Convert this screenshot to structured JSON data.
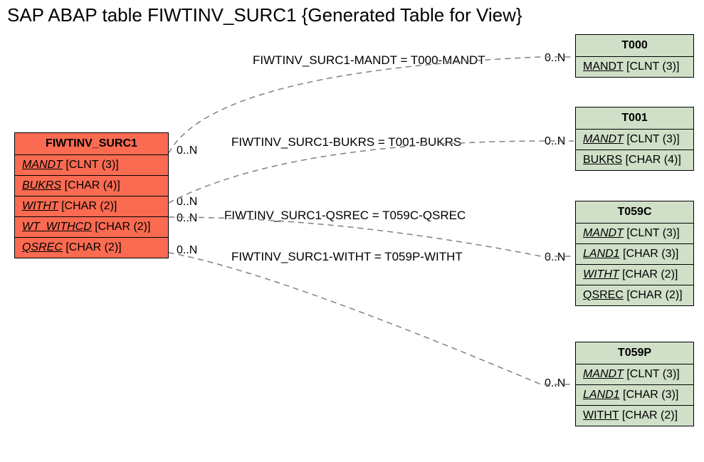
{
  "title": "SAP ABAP table FIWTINV_SURC1 {Generated Table for View}",
  "main_entity": {
    "name": "FIWTINV_SURC1",
    "fields": [
      {
        "field": "MANDT",
        "type": "[CLNT (3)]"
      },
      {
        "field": "BUKRS",
        "type": "[CHAR (4)]"
      },
      {
        "field": "WITHT",
        "type": "[CHAR (2)]"
      },
      {
        "field": "WT_WITHCD",
        "type": "[CHAR (2)]"
      },
      {
        "field": "QSREC",
        "type": "[CHAR (2)]"
      }
    ]
  },
  "related": [
    {
      "name": "T000",
      "fields": [
        {
          "field": "MANDT",
          "type": "[CLNT (3)]",
          "underline": false
        }
      ]
    },
    {
      "name": "T001",
      "fields": [
        {
          "field": "MANDT",
          "type": "[CLNT (3)]",
          "underline": true
        },
        {
          "field": "BUKRS",
          "type": "[CHAR (4)]",
          "underline": false
        }
      ]
    },
    {
      "name": "T059C",
      "fields": [
        {
          "field": "MANDT",
          "type": "[CLNT (3)]",
          "underline": true
        },
        {
          "field": "LAND1",
          "type": "[CHAR (3)]",
          "underline": true
        },
        {
          "field": "WITHT",
          "type": "[CHAR (2)]",
          "underline": true
        },
        {
          "field": "QSREC",
          "type": "[CHAR (2)]",
          "underline": false
        }
      ]
    },
    {
      "name": "T059P",
      "fields": [
        {
          "field": "MANDT",
          "type": "[CLNT (3)]",
          "underline": true
        },
        {
          "field": "LAND1",
          "type": "[CHAR (3)]",
          "underline": true
        },
        {
          "field": "WITHT",
          "type": "[CHAR (2)]",
          "underline": false
        }
      ]
    }
  ],
  "connections": [
    {
      "label": "FIWTINV_SURC1-MANDT = T000-MANDT",
      "card_left": "0..N",
      "card_right": "0..N"
    },
    {
      "label": "FIWTINV_SURC1-BUKRS = T001-BUKRS",
      "card_left": "0..N",
      "card_right": "0..N"
    },
    {
      "label": "FIWTINV_SURC1-QSREC = T059C-QSREC",
      "card_left": "0..N",
      "card_right": "0..N"
    },
    {
      "label": "FIWTINV_SURC1-WITHT = T059P-WITHT",
      "card_left": "0..N",
      "card_right": "0..N"
    }
  ]
}
